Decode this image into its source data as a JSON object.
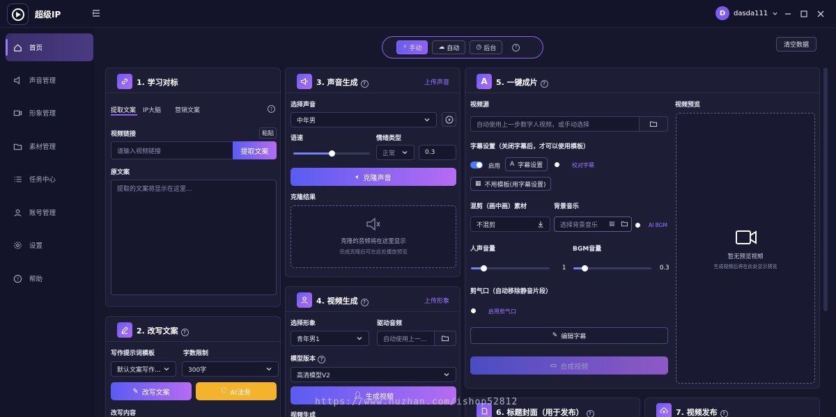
{
  "app": {
    "title": "超级IP",
    "user": {
      "initial": "D",
      "name": "dasda111"
    }
  },
  "sidebar": {
    "items": [
      {
        "label": "首页",
        "icon": "home-icon"
      },
      {
        "label": "声音管理",
        "icon": "speaker-icon"
      },
      {
        "label": "形象管理",
        "icon": "video-icon"
      },
      {
        "label": "素材管理",
        "icon": "folder-icon"
      },
      {
        "label": "任务中心",
        "icon": "list-icon"
      },
      {
        "label": "账号管理",
        "icon": "user-icon"
      },
      {
        "label": "设置",
        "icon": "gear-icon"
      },
      {
        "label": "帮助",
        "icon": "help-icon"
      }
    ]
  },
  "modes": {
    "manual": "手动",
    "auto": "自动",
    "background": "后台"
  },
  "clear_data": "清空数据",
  "p1": {
    "title": "1. 学习对标",
    "tabs": [
      "提取文案",
      "IP大脑",
      "营销文案"
    ],
    "link_label": "视频链接",
    "paste": "粘贴",
    "link_placeholder": "请输入视频链接",
    "extract_btn": "提取文案",
    "source_label": "原文案",
    "source_placeholder": "提取的文案将显示在这里..."
  },
  "p2": {
    "title": "2. 改写文案",
    "template_label": "写作提示词模板",
    "template_value": "默认文案写作...",
    "limit_label": "字数限制",
    "limit_value": "300字",
    "rewrite_btn": "改写文案",
    "ai_btn": "AI法务",
    "content_label": "改写内容"
  },
  "p3": {
    "title": "3. 声音生成",
    "upload": "上传声音",
    "select_label": "选择声音",
    "voice": "中年男",
    "speed_label": "语速",
    "emotion_label": "情绪类型",
    "emotion": "正常",
    "emotion_value": "0.3",
    "clone_btn": "克隆声音",
    "result_label": "克隆结果",
    "empty_title": "克隆的音频将在这里显示",
    "empty_sub": "完成克隆后可在此处播放预览"
  },
  "p4": {
    "title": "4. 视频生成",
    "upload": "上传形象",
    "avatar_label": "选择形象",
    "avatar": "青年男1",
    "audio_label": "驱动音频",
    "audio_value": "自动使用上一...",
    "model_label": "模型版本",
    "model": "高清模型V2",
    "gen_btn": "生成视频",
    "result_label": "视频生成"
  },
  "p5": {
    "title": "5. 一键成片",
    "video_src_label": "视频源",
    "video_src_placeholder": "自动使用上一步数字人视频，或手动选择",
    "subtitle_label": "字幕设置（关闭字幕后，才可以使用模板）",
    "enable": "启用",
    "subtitle_btn": "字幕设置",
    "proof": "校对字幕",
    "no_template": "不用模板(用字幕设置)",
    "mix_label": "混剪（画中画）素材",
    "mix_value": "不混剪",
    "bgm_label": "背景音乐",
    "bgm_placeholder": "选择背景音乐",
    "ai_bgm": "AI BGM",
    "voice_vol_label": "人声音量",
    "voice_vol": "1",
    "bgm_vol_label": "BGM音量",
    "bgm_vol": "0.3",
    "breath_label": "剪气口（自动移除静音片段）",
    "breath_toggle": "启用剪气口",
    "edit_sub_btn": "编辑字幕",
    "compose_btn": "合成视频",
    "preview_label": "视频预览",
    "preview_empty": "暂无预览视频",
    "preview_sub": "生成视频后将在此处显示预览"
  },
  "p6": {
    "title": "6. 标题封面（用于发布）"
  },
  "p7": {
    "title": "7. 视频发布"
  },
  "levels": {
    "speed": 0.5,
    "voice_volume": 0.16,
    "bgm_volume": 0.15
  },
  "watermark": "https://www.huzhan.com/ishop52812",
  "colors": {
    "accent": "#8a64f0",
    "ai_button": "#f5b22b",
    "toggle": "#4f7cf5"
  }
}
